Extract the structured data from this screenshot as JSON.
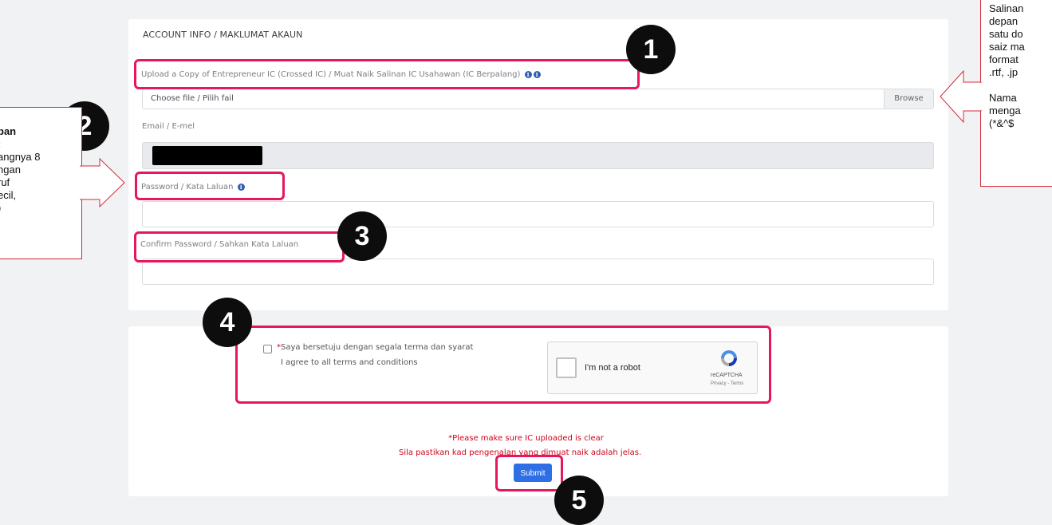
{
  "account_section": {
    "title": "ACCOUNT INFO / MAKLUMAT AKAUN",
    "upload_label": "Upload a Copy of Entrepreneur IC (Crossed IC) / Muat Naik Salinan IC Usahawan (IC Berpalang)",
    "file_placeholder": "Choose file / Pilih fail",
    "browse_label": "Browse",
    "email_label": "Email / E-mel",
    "password_label": "Password / Kata Laluan",
    "confirm_password_label": "Confirm Password / Sahkan Kata Laluan"
  },
  "terms_section": {
    "agree_required_mark": "*",
    "agree_malay": "Saya bersetuju dengan segala terma dan syarat",
    "agree_english": "I agree to all terms and conditions",
    "captcha_text": "I'm not a robot",
    "captcha_brand": "reCAPTCHA",
    "captcha_links": "Privacy - Terms"
  },
  "notice": {
    "line1": "*Please make sure IC uploaded is clear",
    "line2": "Sila pastikan kad pengenalan yang dimuat naik adalah jelas."
  },
  "submit_label": "Submit",
  "badges": [
    "1",
    "2",
    "3",
    "4",
    "5"
  ],
  "callout_left": {
    "heading1": "pan",
    "heading2": ":",
    "lines": [
      "angnya 8",
      "ngan",
      "ruf",
      "ecil,",
      ")"
    ]
  },
  "callout_right": {
    "lines": [
      "Salinan",
      "depan",
      "satu do",
      "saiz ma",
      "format",
      ".rtf, .jp",
      "",
      "Nama",
      "menga",
      "(*&^$"
    ]
  },
  "colors": {
    "highlight": "#e6175f",
    "submit": "#2e6fe6",
    "warning": "#d0021b",
    "info_icon": "#2f5fb4"
  },
  "icons": [
    "info-icon",
    "recaptcha-logo-icon",
    "arrow-callout-icon"
  ]
}
